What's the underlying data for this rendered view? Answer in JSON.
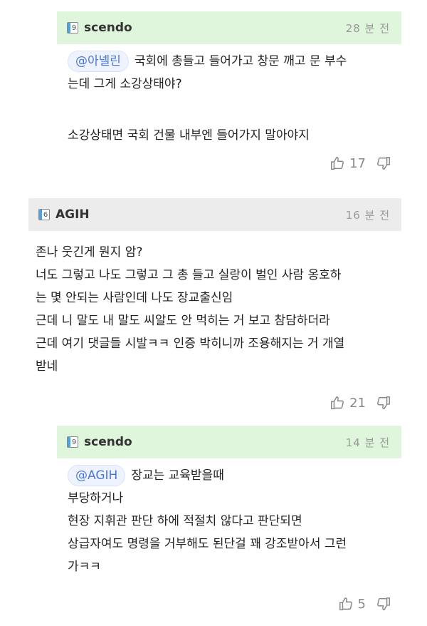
{
  "comments": [
    {
      "nickname": "scendo",
      "level": "9",
      "time": "28 분 전",
      "mention": "@아넬린",
      "lines": [
        "국회에 총들고 들어가고 창문 깨고 문 부수",
        "는데 그게 소강상태야?",
        "",
        "소강상태면 국회 건물 내부엔 들어가지 말아야지"
      ],
      "likes": "17"
    },
    {
      "nickname": "AGIH",
      "level": "6",
      "time": "16 분 전",
      "lines": [
        "존나 웃긴게 뭔지 암?",
        "너도 그렇고 나도 그렇고 그 총 들고 실랑이 벌인 사람 옹호하",
        "는 몇 안되는 사람인데 나도 장교출신임",
        "근데 니 말도 내 말도 씨알도 안 먹히는 거 보고 참담하더라",
        "근데 여기 댓글들 시발ㅋㅋ 인증 박히니까 조용해지는 거 개열",
        "받네"
      ],
      "likes": "21"
    },
    {
      "nickname": "scendo",
      "level": "9",
      "time": "14 분 전",
      "mention": "@AGIH",
      "lines": [
        "장교는 교육받을때",
        "부당하거나",
        "현장 지휘관 판단 하에 적절치 않다고 판단되면",
        "상급자여도 명령을 거부해도 된단걸 꽤 강조받아서 그런",
        "가ㅋㅋ"
      ],
      "likes": "5"
    }
  ],
  "icons": {
    "like": "thumbs-up-icon",
    "dislike": "thumbs-down-icon"
  },
  "colors": {
    "reply_header": "#dff5dc",
    "comment_header": "#ececec",
    "mention": "#4a78d8"
  }
}
